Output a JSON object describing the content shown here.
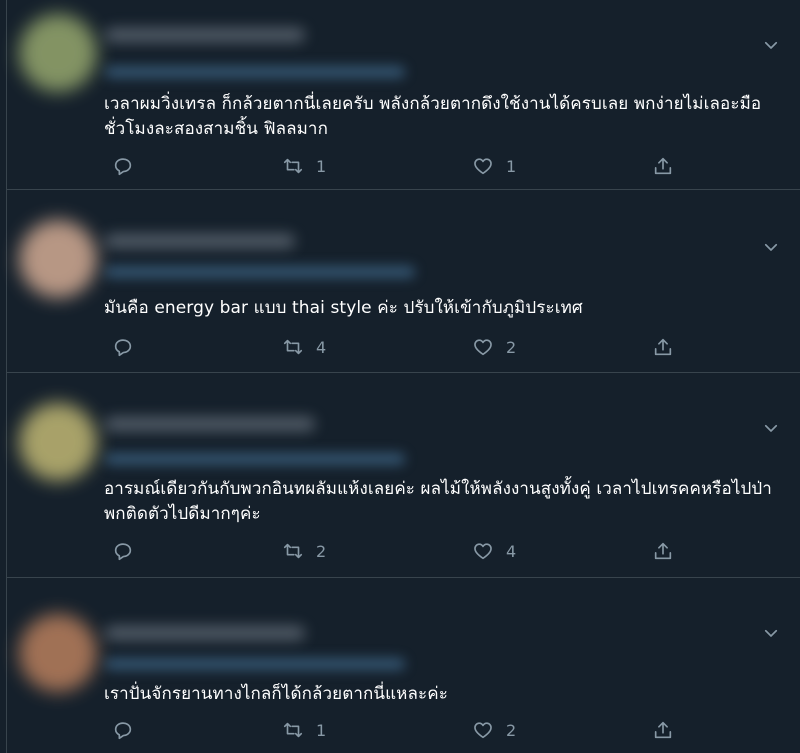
{
  "tweets": [
    {
      "text": "เวลาผมวิ่งเทรล ก็กล้วยตากนี่เลยครับ  พลังกล้วยตากดึงใช้งานได้ครบเลย  พกง่ายไม่เลอะมือ ชั่วโมงละสองสามชิ้น ฟิลลมาก",
      "reply_count": "",
      "retweet_count": "1",
      "like_count": "1",
      "avatar_color": "#8fa06a"
    },
    {
      "text": "มันคือ energy bar แบบ thai style ค่ะ ปรับให้เข้ากับภูมิประเทศ",
      "reply_count": "",
      "retweet_count": "4",
      "like_count": "2",
      "avatar_color": "#c9a48e"
    },
    {
      "text": "อารมณ์เดียวกันกับพวกอินทผลัมแห้งเลยค่ะ ผลไม้ให้พลังงานสูงทั้งคู่ เวลาไปเทรคคหรือไปป่าพกติดตัวไปดีมากๆค่ะ",
      "reply_count": "",
      "retweet_count": "2",
      "like_count": "4",
      "avatar_color": "#b8b070"
    },
    {
      "text": "เราปั่นจักรยานทางไกลก็ได้กล้วยตากนี่แหละค่ะ",
      "reply_count": "",
      "retweet_count": "1",
      "like_count": "2",
      "avatar_color": "#b07a5a"
    }
  ],
  "colors": {
    "background": "#15202b",
    "divider": "#38444d",
    "muted": "#8899a6",
    "text": "#ffffff"
  },
  "icons": {
    "menu": "chevron-down-icon",
    "reply": "reply-icon",
    "retweet": "retweet-icon",
    "like": "heart-icon",
    "share": "share-icon"
  }
}
